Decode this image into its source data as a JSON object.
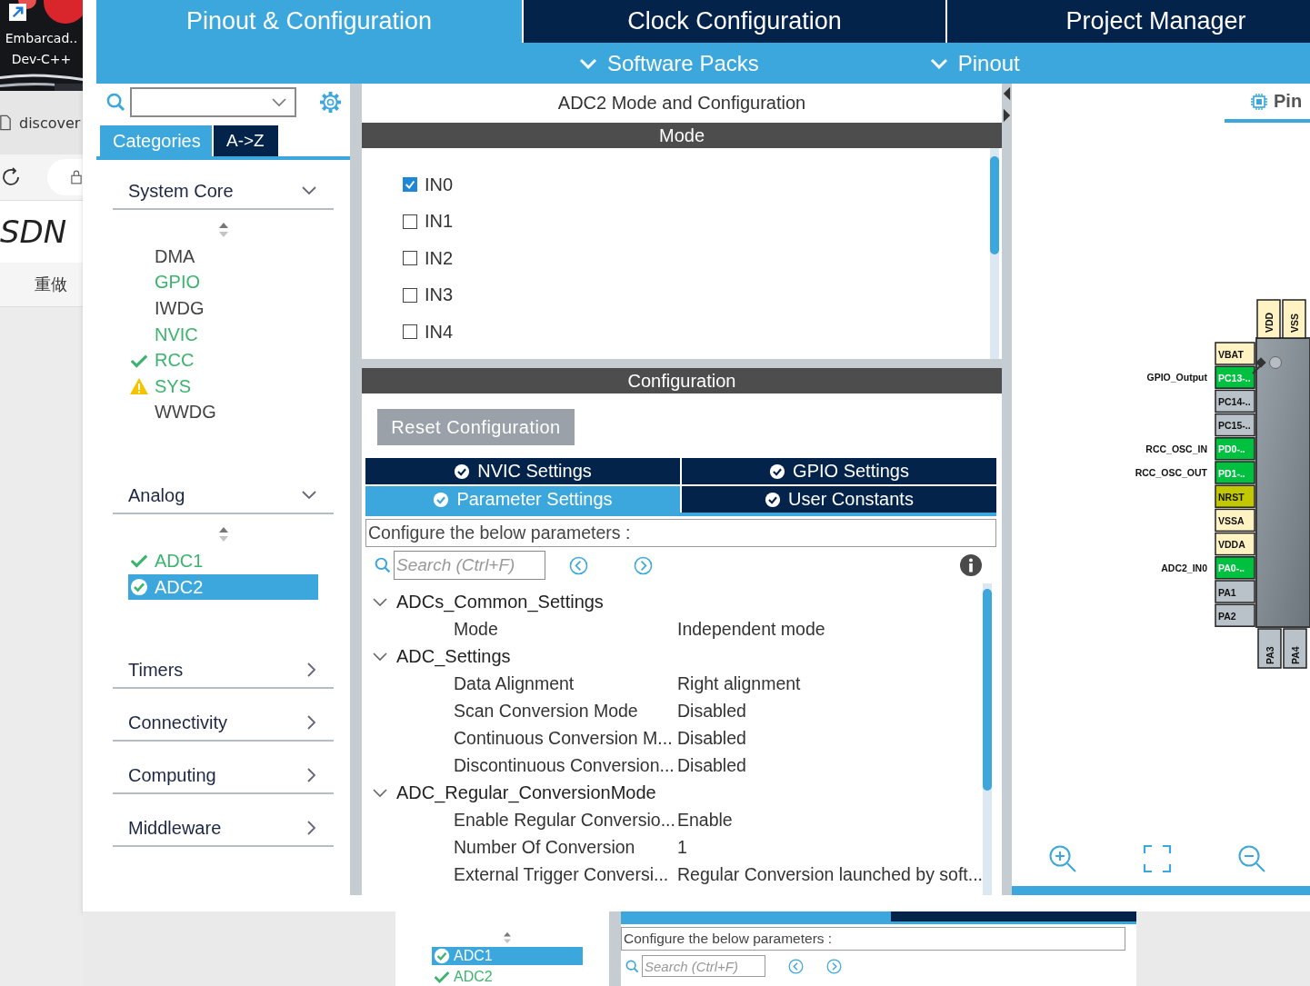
{
  "desktop_icon": {
    "label_lines": [
      "Embarcad..",
      "Dev-C++"
    ]
  },
  "browser": {
    "tab_title": "discover",
    "logo_text": "SDN",
    "toolbar_label": "重做"
  },
  "top_tabs": [
    {
      "label": "Pinout & Configuration",
      "selected": true
    },
    {
      "label": "Clock Configuration",
      "selected": false
    },
    {
      "label": "Project Manager",
      "selected": false
    }
  ],
  "menus": [
    "Software Packs",
    "Pinout"
  ],
  "category_panel": {
    "view_tabs": [
      {
        "label": "Categories",
        "selected": true
      },
      {
        "label": "A->Z",
        "selected": false
      }
    ],
    "groups": [
      {
        "label": "System Core",
        "expanded": true,
        "items": [
          {
            "label": "DMA",
            "configured": false,
            "selected": false
          },
          {
            "label": "GPIO",
            "configured": true,
            "selected": false
          },
          {
            "label": "IWDG",
            "configured": false,
            "selected": false
          },
          {
            "label": "NVIC",
            "configured": true,
            "selected": false
          },
          {
            "label": "RCC",
            "configured": true,
            "ok": true,
            "selected": false
          },
          {
            "label": "SYS",
            "configured": true,
            "warning": true,
            "selected": false
          },
          {
            "label": "WWDG",
            "configured": false,
            "selected": false
          }
        ]
      },
      {
        "label": "Analog",
        "expanded": true,
        "items": [
          {
            "label": "ADC1",
            "configured": true,
            "ok": true,
            "selected": false
          },
          {
            "label": "ADC2",
            "configured": true,
            "ok": true,
            "selected": true
          }
        ]
      },
      {
        "label": "Timers",
        "expanded": false
      },
      {
        "label": "Connectivity",
        "expanded": false
      },
      {
        "label": "Computing",
        "expanded": false
      },
      {
        "label": "Middleware",
        "expanded": false
      }
    ]
  },
  "mode_panel": {
    "title": "ADC2 Mode and Configuration",
    "header": "Mode",
    "channels": [
      {
        "label": "IN0",
        "checked": true
      },
      {
        "label": "IN1",
        "checked": false
      },
      {
        "label": "IN2",
        "checked": false
      },
      {
        "label": "IN3",
        "checked": false
      },
      {
        "label": "IN4",
        "checked": false
      }
    ]
  },
  "config_panel": {
    "header": "Configuration",
    "reset_button": "Reset Configuration",
    "tabs": [
      {
        "label": "NVIC Settings",
        "selected": false
      },
      {
        "label": "GPIO Settings",
        "selected": false
      },
      {
        "label": "Parameter Settings",
        "selected": true
      },
      {
        "label": "User Constants",
        "selected": false
      }
    ],
    "hint": "Configure the below parameters :",
    "search": {
      "placeholder": "Search (Ctrl+F)"
    },
    "parameters": [
      {
        "label": "ADCs_Common_Settings",
        "expanded": true,
        "children": [
          {
            "label": "Mode",
            "value": "Independent mode"
          }
        ]
      },
      {
        "label": "ADC_Settings",
        "expanded": true,
        "children": [
          {
            "label": "Data Alignment",
            "value": "Right alignment"
          },
          {
            "label": "Scan Conversion Mode",
            "value": "Disabled"
          },
          {
            "label": "Continuous Conversion M...",
            "value": "Disabled"
          },
          {
            "label": "Discontinuous Conversion...",
            "value": "Disabled"
          }
        ]
      },
      {
        "label": "ADC_Regular_ConversionMode",
        "expanded": true,
        "children": [
          {
            "label": "Enable Regular Conversio...",
            "value": "Enable"
          },
          {
            "label": "Number Of Conversion",
            "value": "1"
          },
          {
            "label": "External Trigger Conversi...",
            "value": "Regular Conversion launched by soft..."
          }
        ]
      }
    ]
  },
  "pinout_panel": {
    "view_tab": {
      "label": "Pin",
      "selected": true
    },
    "top_pins": [
      {
        "name": "VDD",
        "color": "#fff3c4"
      },
      {
        "name": "VSS",
        "color": "#fff3c4"
      }
    ],
    "left_pins": [
      {
        "name": "VBAT",
        "color": "#fff3c4"
      },
      {
        "name": "PC13-..",
        "color": "#00c040",
        "signal": "GPIO_Output"
      },
      {
        "name": "PC14-..",
        "color": "#b9c2c9"
      },
      {
        "name": "PC15-..",
        "color": "#b9c2c9"
      },
      {
        "name": "PD0-..",
        "color": "#00c040",
        "signal": "RCC_OSC_IN"
      },
      {
        "name": "PD1-..",
        "color": "#00c040",
        "signal": "RCC_OSC_OUT"
      },
      {
        "name": "NRST",
        "color": "#c2c800"
      },
      {
        "name": "VSSA",
        "color": "#fff3c4"
      },
      {
        "name": "VDDA",
        "color": "#fff3c4"
      },
      {
        "name": "PA0-..",
        "color": "#00c040",
        "signal": "ADC2_IN0"
      },
      {
        "name": "PA1",
        "color": "#b9c2c9"
      },
      {
        "name": "PA2",
        "color": "#b9c2c9"
      }
    ],
    "bottom_pins": [
      {
        "name": "PA3",
        "color": "#b9c2c9"
      },
      {
        "name": "PA4",
        "color": "#b9c2c9"
      }
    ]
  },
  "background_window": {
    "items": [
      {
        "label": "ADC1",
        "selected": true
      },
      {
        "label": "ADC2",
        "selected": false
      }
    ],
    "hint": "Configure the below parameters :",
    "search": {
      "placeholder": "Search (Ctrl+F)"
    }
  }
}
